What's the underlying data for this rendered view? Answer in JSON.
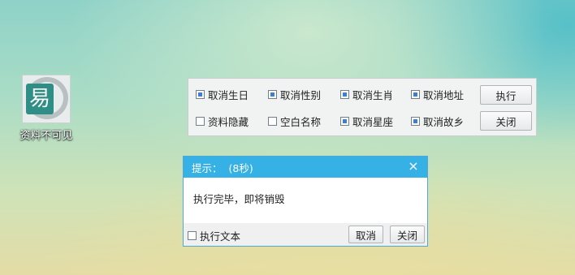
{
  "desktop": {
    "icon_label": "资料不可见",
    "icon_glyph": "易"
  },
  "panel": {
    "options": [
      {
        "label": "取消生日",
        "checked": true
      },
      {
        "label": "取消性别",
        "checked": true
      },
      {
        "label": "取消生肖",
        "checked": true
      },
      {
        "label": "取消地址",
        "checked": true
      },
      {
        "label": "资料隐藏",
        "checked": false
      },
      {
        "label": "空白名称",
        "checked": false
      },
      {
        "label": "取消星座",
        "checked": true
      },
      {
        "label": "取消故乡",
        "checked": true
      }
    ],
    "execute_label": "执行",
    "close_label": "关闭"
  },
  "dialog": {
    "title": "提示：",
    "countdown": "(8秒)",
    "message": "执行完毕，即将销毁",
    "checkbox_label": "执行文本",
    "checkbox_checked": false,
    "cancel_label": "取消",
    "close_label": "关闭",
    "close_icon": "×"
  },
  "colors": {
    "titlebar": "#35b1e6",
    "checked_fill": "#3a7fd5"
  }
}
